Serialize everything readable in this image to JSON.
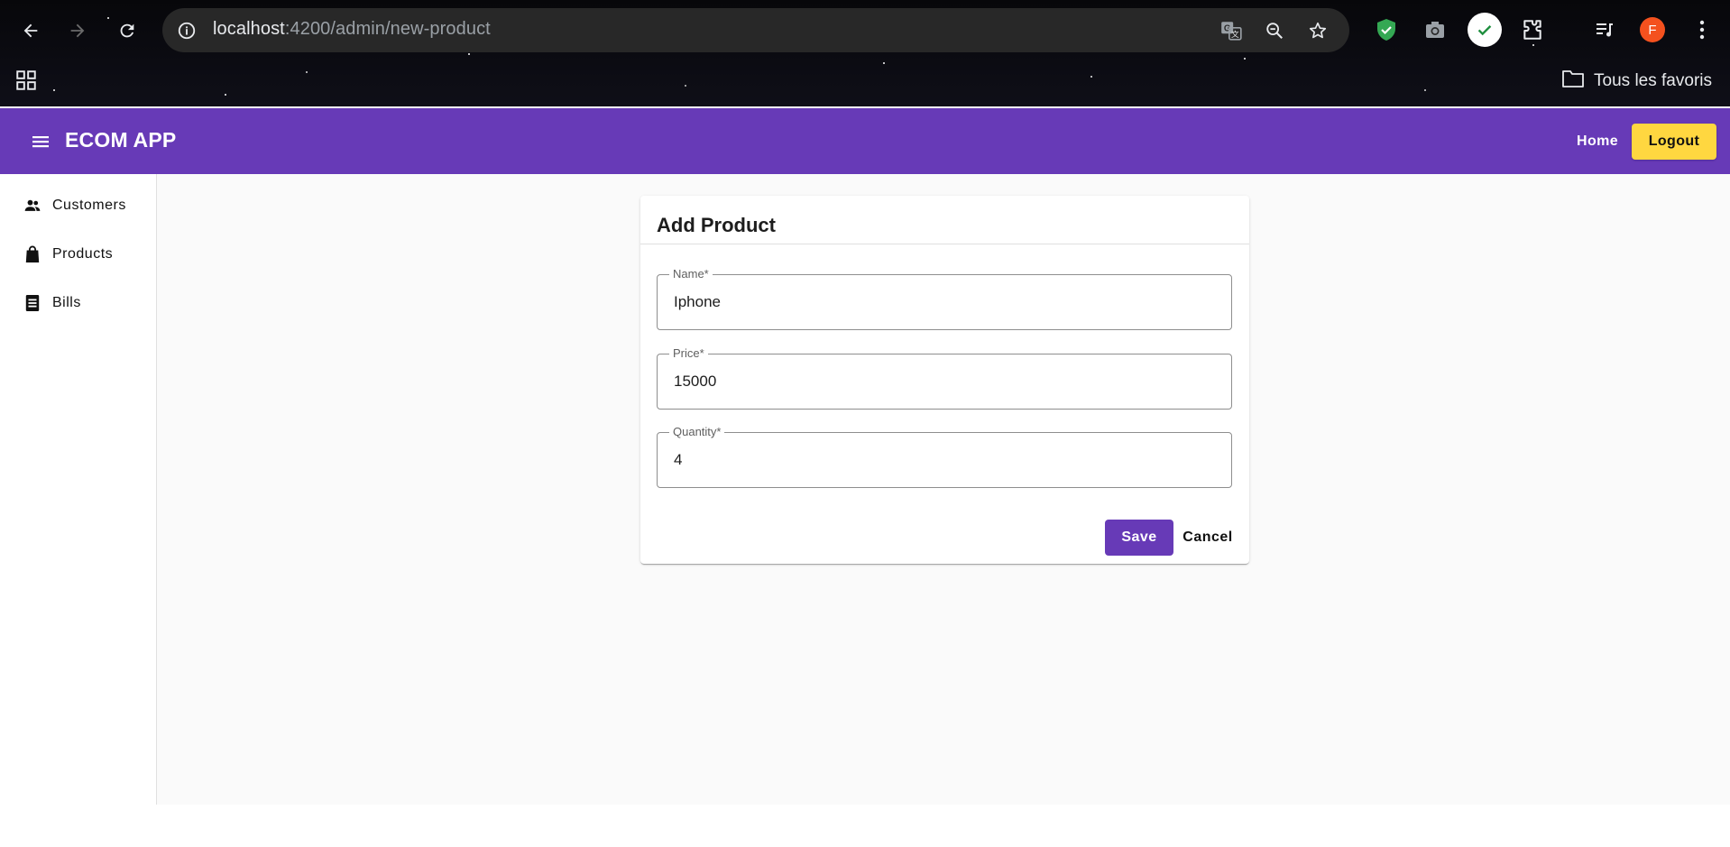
{
  "browser": {
    "url_host": "localhost",
    "url_path": ":4200/admin/new-product",
    "bookmarks_label": "Tous les favoris",
    "profile_initial": "F",
    "icons": [
      "back-icon",
      "forward-icon",
      "reload-icon",
      "site-info-icon",
      "translate-icon",
      "zoom-out-icon",
      "star-icon",
      "shield-extension-icon",
      "camera-extension-icon",
      "check-extension-icon",
      "puzzle-extensions-icon",
      "media-queue-icon",
      "kebab-menu-icon",
      "apps-grid-icon",
      "folder-icon"
    ]
  },
  "app": {
    "title": "ECOM APP",
    "home_label": "Home",
    "logout_label": "Logout",
    "colors": {
      "primary": "#673ab7",
      "accent": "#ffd740"
    }
  },
  "sidebar": {
    "items": [
      {
        "label": "Customers",
        "icon": "people-icon"
      },
      {
        "label": "Products",
        "icon": "shopping-bag-icon"
      },
      {
        "label": "Bills",
        "icon": "receipt-icon"
      }
    ]
  },
  "form": {
    "title": "Add Product",
    "fields": [
      {
        "label": "Name*",
        "value": "Iphone"
      },
      {
        "label": "Price*",
        "value": "15000"
      },
      {
        "label": "Quantity*",
        "value": "4"
      }
    ],
    "save_label": "Save",
    "cancel_label": "Cancel"
  }
}
